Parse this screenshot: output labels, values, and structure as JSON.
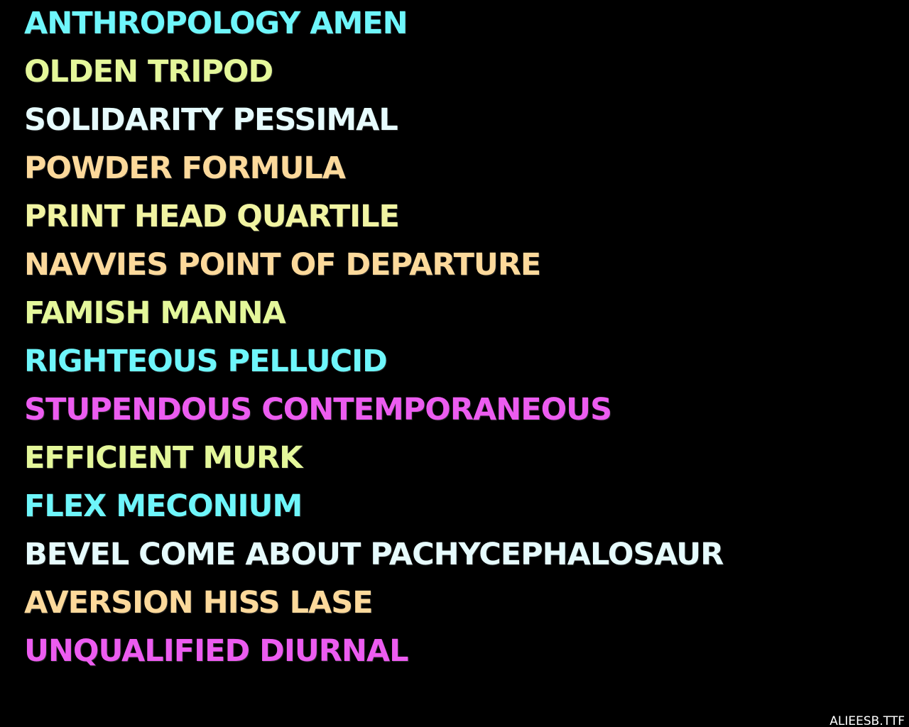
{
  "phrases": [
    {
      "text": "ANTHROPOLOGY AMEN",
      "color": "#6ef6fb"
    },
    {
      "text": "OLDEN TRIPOD",
      "color": "#e4f79a"
    },
    {
      "text": "SOLIDARITY PESSIMAL",
      "color": "#e6fbfd"
    },
    {
      "text": "POWDER FORMULA",
      "color": "#fcd99b"
    },
    {
      "text": "PRINT HEAD QUARTILE",
      "color": "#f1f4a2"
    },
    {
      "text": "NAVVIES POINT OF DEPARTURE",
      "color": "#fcd99b"
    },
    {
      "text": "FAMISH MANNA",
      "color": "#e4f79a"
    },
    {
      "text": "RIGHTEOUS PELLUCID",
      "color": "#6ef6fb"
    },
    {
      "text": "STUPENDOUS CONTEMPORANEOUS",
      "color": "#ec5cf0"
    },
    {
      "text": "EFFICIENT MURK",
      "color": "#e4f79a"
    },
    {
      "text": "FLEX MECONIUM",
      "color": "#6ef6fb"
    },
    {
      "text": "BEVEL COME ABOUT PACHYCEPHALOSAUR",
      "color": "#e6fbfd"
    },
    {
      "text": "AVERSION HISS LASE",
      "color": "#fcd99b"
    },
    {
      "text": "UNQUALIFIED DIURNAL",
      "color": "#ec5cf0"
    }
  ],
  "font_file": "ALIEESB.TTF",
  "background_color": "#000000"
}
